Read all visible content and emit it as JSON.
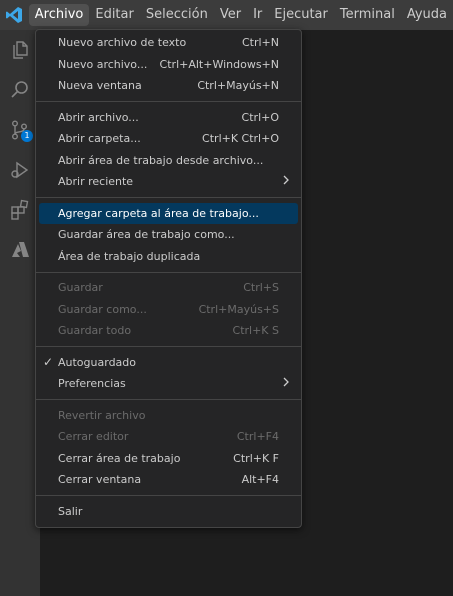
{
  "menubar": {
    "items": [
      "Archivo",
      "Editar",
      "Selección",
      "Ver",
      "Ir",
      "Ejecutar",
      "Terminal",
      "Ayuda"
    ]
  },
  "activity": {
    "badge": "1"
  },
  "menu": {
    "groups": [
      [
        {
          "label": "Nuevo archivo de texto",
          "shortcut": "Ctrl+N"
        },
        {
          "label": "Nuevo archivo...",
          "shortcut": "Ctrl+Alt+Windows+N"
        },
        {
          "label": "Nueva ventana",
          "shortcut": "Ctrl+Mayús+N"
        }
      ],
      [
        {
          "label": "Abrir archivo...",
          "shortcut": "Ctrl+O"
        },
        {
          "label": "Abrir carpeta...",
          "shortcut": "Ctrl+K Ctrl+O"
        },
        {
          "label": "Abrir área de trabajo desde archivo...",
          "shortcut": ""
        },
        {
          "label": "Abrir reciente",
          "shortcut": ""
        }
      ],
      [
        {
          "label": "Agregar carpeta al área de trabajo...",
          "shortcut": ""
        },
        {
          "label": "Guardar área de trabajo como...",
          "shortcut": ""
        },
        {
          "label": "Área de trabajo duplicada",
          "shortcut": ""
        }
      ],
      [
        {
          "label": "Guardar",
          "shortcut": "Ctrl+S"
        },
        {
          "label": "Guardar como...",
          "shortcut": "Ctrl+Mayús+S"
        },
        {
          "label": "Guardar todo",
          "shortcut": "Ctrl+K S"
        }
      ],
      [
        {
          "label": "Autoguardado",
          "shortcut": ""
        },
        {
          "label": "Preferencias",
          "shortcut": ""
        }
      ],
      [
        {
          "label": "Revertir archivo",
          "shortcut": ""
        },
        {
          "label": "Cerrar editor",
          "shortcut": "Ctrl+F4"
        },
        {
          "label": "Cerrar área de trabajo",
          "shortcut": "Ctrl+K F"
        },
        {
          "label": "Cerrar ventana",
          "shortcut": "Alt+F4"
        }
      ],
      [
        {
          "label": "Salir",
          "shortcut": ""
        }
      ]
    ]
  },
  "colors": {
    "highlight": "#04395e",
    "accent": "#0078d4"
  }
}
